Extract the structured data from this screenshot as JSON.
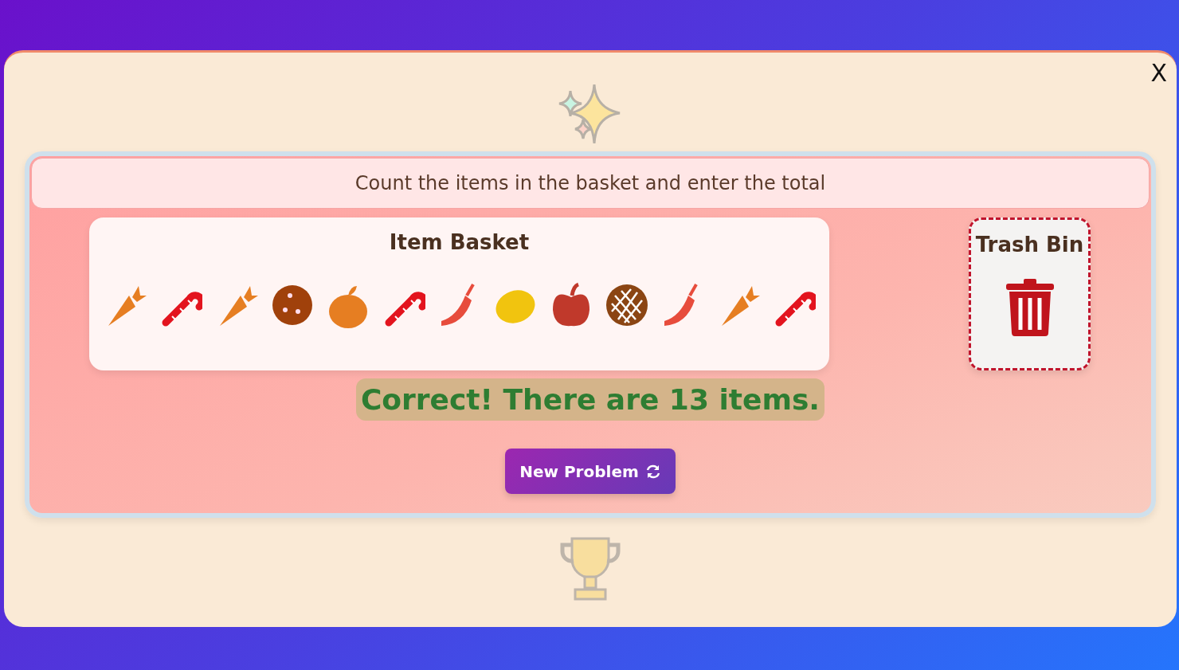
{
  "close_label": "X",
  "instruction": "Count the items in the basket and enter the total",
  "basket": {
    "title": "Item Basket",
    "items": [
      {
        "kind": "carrot"
      },
      {
        "kind": "candy-cane"
      },
      {
        "kind": "carrot"
      },
      {
        "kind": "cookie"
      },
      {
        "kind": "orange"
      },
      {
        "kind": "candy-cane"
      },
      {
        "kind": "chili"
      },
      {
        "kind": "lemon"
      },
      {
        "kind": "apple"
      },
      {
        "kind": "pie"
      },
      {
        "kind": "chili"
      },
      {
        "kind": "carrot"
      },
      {
        "kind": "candy-cane"
      }
    ]
  },
  "trash": {
    "title": "Trash Bin"
  },
  "feedback": "Correct! There are 13 items.",
  "new_problem_button": "New Problem"
}
